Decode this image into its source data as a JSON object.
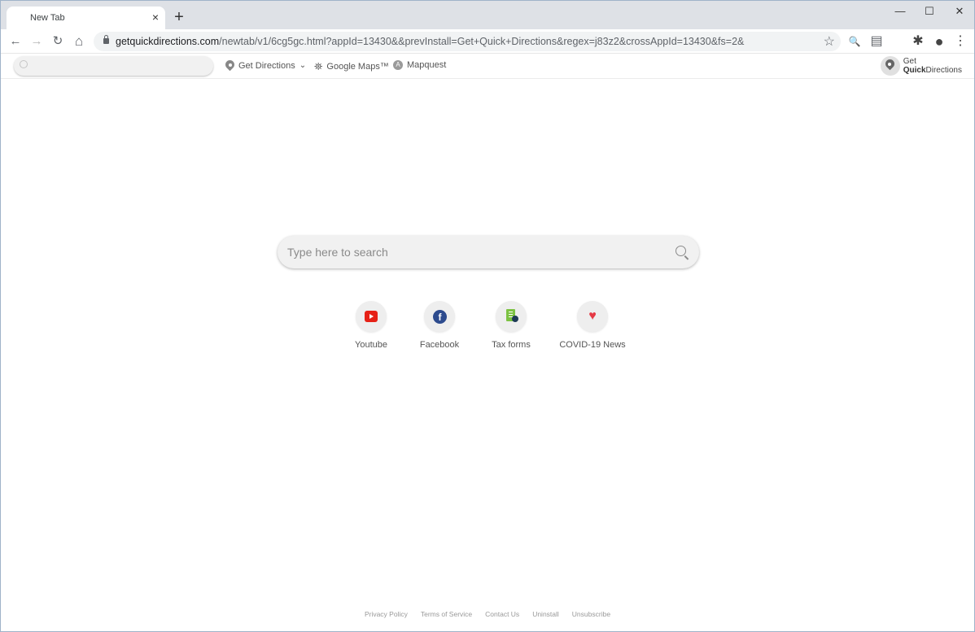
{
  "browser": {
    "tab": {
      "title": "New Tab",
      "close_icon": "×"
    },
    "new_tab_icon": "+",
    "window_controls": {
      "minimize": "—",
      "maximize": "☐",
      "close": "✕"
    },
    "nav": {
      "back": "←",
      "forward": "→",
      "reload": "↻",
      "home": "⌂"
    },
    "url": {
      "host": "getquickdirections.com",
      "path": "/newtab/v1/6cg5gc.html?appId=13430&&prevInstall=Get+Quick+Directions&regex=j83z2&crossAppId=13430&fs=2&"
    },
    "icons": {
      "star": "☆",
      "zoom": "🔍",
      "reader": "▤",
      "extensions": "✱",
      "profile": "●",
      "menu": "⋮"
    }
  },
  "extbar": {
    "search_placeholder": "",
    "links": [
      {
        "label": "Get Directions",
        "icon": "pin-icon",
        "has_dropdown": true,
        "chevron": "⌄"
      },
      {
        "label": "Google Maps™",
        "icon": "map-person-icon"
      },
      {
        "label": "Mapquest",
        "icon": "mapquest-icon",
        "glyph": "A"
      }
    ],
    "logo": {
      "line1": "Get",
      "line2_bold": "Quick",
      "line2_rest": "Directions"
    }
  },
  "main": {
    "search_placeholder": "Type here to search",
    "tiles": [
      {
        "label": "Youtube",
        "icon": "youtube-icon"
      },
      {
        "label": "Facebook",
        "icon": "facebook-icon",
        "glyph": "f"
      },
      {
        "label": "Tax forms",
        "icon": "tax-forms-icon"
      },
      {
        "label": "COVID-19 News",
        "icon": "heart-pulse-icon",
        "glyph": "♥"
      }
    ]
  },
  "footer": {
    "links": [
      "Privacy Policy",
      "Terms of Service",
      "Contact Us",
      "Uninstall",
      "Unsubscribe"
    ]
  }
}
